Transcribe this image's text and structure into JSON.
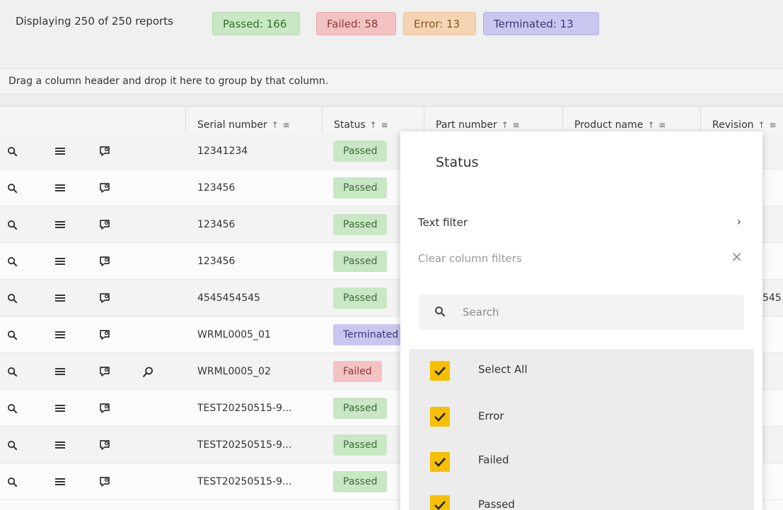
{
  "summary": {
    "displaying": "Displaying 250 of 250 reports",
    "passed": "Passed: 166",
    "failed": "Failed: 58",
    "error": "Error: 13",
    "terminated": "Terminated: 13"
  },
  "group_bar": {
    "text": "Drag a column header and drop it here to group by that column."
  },
  "columns": [
    {
      "label": "Serial number"
    },
    {
      "label": "Status"
    },
    {
      "label": "Part number"
    },
    {
      "label": "Product name"
    },
    {
      "label": "Revision"
    }
  ],
  "sort_glyph": "↑ ≡",
  "rows": [
    {
      "serial": "12341234",
      "status": "Passed",
      "status_kind": "passed",
      "extra": ""
    },
    {
      "serial": "123456",
      "status": "Passed",
      "status_kind": "passed",
      "extra": ""
    },
    {
      "serial": "123456",
      "status": "Passed",
      "status_kind": "passed",
      "extra": ""
    },
    {
      "serial": "123456",
      "status": "Passed",
      "status_kind": "passed",
      "extra": ""
    },
    {
      "serial": "4545454545",
      "status": "Passed",
      "status_kind": "passed",
      "extra": "545"
    },
    {
      "serial": "WRML0005_01",
      "status": "Terminated",
      "status_kind": "terminated",
      "extra": ""
    },
    {
      "serial": "WRML0005_02",
      "status": "Failed",
      "status_kind": "failed",
      "extra": "",
      "has_extra_icon": true
    },
    {
      "serial": "TEST20250515-9...",
      "status": "Passed",
      "status_kind": "passed",
      "extra": ""
    },
    {
      "serial": "TEST20250515-9...",
      "status": "Passed",
      "status_kind": "passed",
      "extra": ""
    },
    {
      "serial": "TEST20250515-9...",
      "status": "Passed",
      "status_kind": "passed",
      "extra": ""
    }
  ],
  "row_icons": [
    "search-icon",
    "menu-icon",
    "comment-icon"
  ],
  "filter_popup": {
    "title": "Status",
    "text_filter": "Text filter",
    "clear_filters": "Clear column filters",
    "search_placeholder": "Search",
    "options": [
      {
        "label": "Select All",
        "checked": true
      },
      {
        "label": "Error",
        "checked": true
      },
      {
        "label": "Failed",
        "checked": true
      },
      {
        "label": "Passed",
        "checked": true
      }
    ]
  },
  "colors": {
    "passed": "#c7e8c3",
    "failed": "#f3c2c2",
    "error": "#f6d4b3",
    "terminated": "#c9c7ef",
    "checkbox": "#f6c000"
  }
}
